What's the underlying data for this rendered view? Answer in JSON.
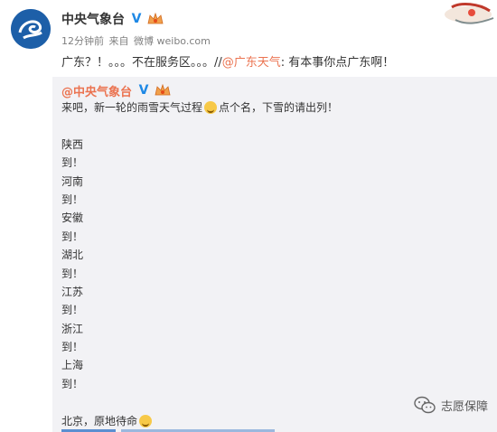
{
  "post": {
    "username": "中央气象台",
    "verified_label": "V",
    "time": "12分钟前",
    "source_prefix": "来自",
    "source": "微博 weibo.com",
    "text_before": "广东？！。。。不在服务区。。。//",
    "mention": "@广东天气",
    "text_after": ": 有本事你点广东啊！"
  },
  "repost": {
    "username": "@中央气象台",
    "verified_label": "V",
    "line1_before": "来吧，新一轮的雨雪天气过程",
    "line1_after": "点个名，下雪的请出列！",
    "lines": [
      "陕西",
      "到！",
      "河南",
      "到！",
      "安徽",
      "到！",
      "湖北",
      "到！",
      "江苏",
      "到！",
      "浙江",
      "到！",
      "上海",
      "到！"
    ],
    "last_line": "北京，原地待命"
  },
  "watermark": {
    "text": "志愿保障"
  },
  "colors": {
    "mention": "#eb7350",
    "repost_bg": "#f2f2f5",
    "verified": "#1e88e5",
    "avatar": "#1d5fa8"
  },
  "icons": [
    "avatar-logo",
    "verified-icon",
    "member-crown-icon",
    "smile-emoji-icon",
    "wechat-icon"
  ]
}
